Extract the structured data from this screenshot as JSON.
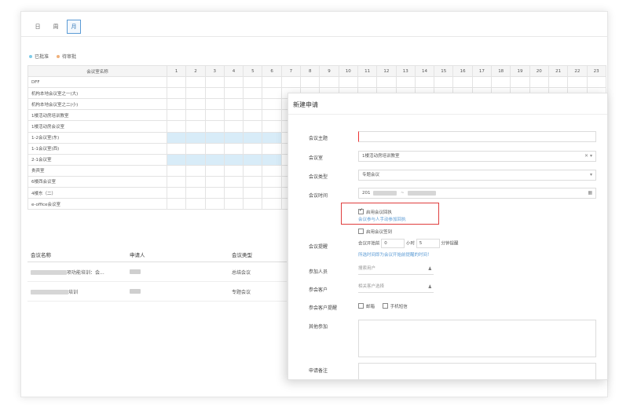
{
  "view_tabs": [
    "日",
    "周",
    "月"
  ],
  "active_tab": "月",
  "legend": [
    {
      "label": "已批准",
      "color": "#7ecbe8"
    },
    {
      "label": "待审批",
      "color": "#f0b07a"
    }
  ],
  "grid": {
    "room_header": "会议室名称",
    "days": [
      "1",
      "2",
      "3",
      "4",
      "5",
      "6",
      "7",
      "8",
      "9",
      "10",
      "11",
      "12",
      "13",
      "14",
      "15",
      "16",
      "17",
      "18",
      "19",
      "20",
      "21",
      "22",
      "23"
    ],
    "rooms": [
      "DFF",
      "机构本地会议室之一(大)",
      "机构本地会议室之二(小)",
      "1楼活动房培训教室",
      "1楼活动房会议室",
      "1-2会议室(东)",
      "1-1会议室(西)",
      "2-1会议室",
      "贵宾室",
      "6楼西会议室",
      "4楼东（二）",
      "e-office会议室"
    ],
    "booked": {
      "1-2会议室(东)": [
        1,
        2,
        3,
        4,
        5,
        6
      ],
      "2-1会议室": [
        1,
        2,
        3,
        4,
        5,
        6
      ]
    }
  },
  "list": {
    "headers": [
      "会议名称",
      "申请人",
      "会议类型"
    ],
    "rows": [
      {
        "name": "项功能培训：会...",
        "type": "总结会议"
      },
      {
        "name": "培训",
        "type": "专题会议"
      }
    ]
  },
  "modal": {
    "title": "新建申请",
    "fields": {
      "subject_label": "会议主题",
      "room_label": "会议室",
      "room_value": "1楼活动房培训教室",
      "room_clear": "✕ ▾",
      "type_label": "会议类型",
      "type_value": "专题会议",
      "type_arrow": "▾",
      "time_label": "会议时间",
      "time_value": "201",
      "receipt_label": "启用会议回执",
      "receipt_hint": "会议参与人手动参加回执",
      "signin_label": "启用会议签到",
      "remind_label": "会议提醒",
      "remind_prefix": "会议开始前",
      "remind_hours": "0",
      "remind_hours_unit": "小时",
      "remind_minutes": "5",
      "remind_minutes_unit": "分钟提醒",
      "remind_hint": "所选时间即为会议开始前提醒的时间！",
      "participants_label": "参加人员",
      "participants_placeholder": "搜索用户",
      "customers_label": "参会客户",
      "customers_placeholder": "相关客户选择",
      "customer_remind_label": "参会客户提醒",
      "email_label": "邮箱",
      "sms_label": "手机短信",
      "others_label": "其他参加",
      "remark_label": "申请备注"
    }
  }
}
